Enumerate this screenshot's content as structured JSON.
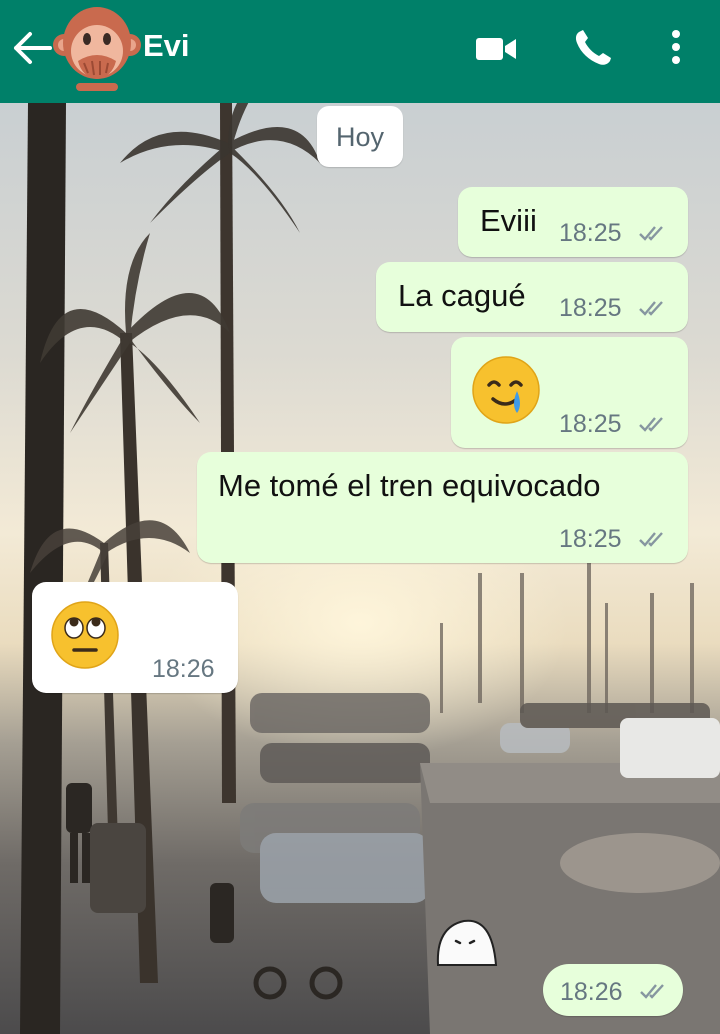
{
  "header": {
    "contact_name": "Evi",
    "icons": [
      "back-arrow-icon",
      "monkey-avatar",
      "video-call-icon",
      "phone-icon",
      "more-options-icon"
    ],
    "color": "#008069"
  },
  "date_divider": "Hoy",
  "messages": [
    {
      "direction": "outgoing",
      "text": "Eviii",
      "time": "18:25",
      "status": "read-double-check"
    },
    {
      "direction": "outgoing",
      "text": "La cagué",
      "time": "18:25",
      "status": "read-double-check"
    },
    {
      "direction": "outgoing",
      "emoji": "crying-face-emoji",
      "time": "18:25",
      "status": "read-double-check"
    },
    {
      "direction": "outgoing",
      "text": "Me tomé el tren equivocado",
      "time": "18:25",
      "status": "read-double-check"
    },
    {
      "direction": "incoming",
      "emoji": "rolling-eyes-emoji",
      "time": "18:26"
    },
    {
      "direction": "outgoing",
      "sticker": "white-blob-sticker",
      "time": "18:26",
      "status": "read-double-check"
    }
  ],
  "colors": {
    "outgoing_bubble": "#e7ffdb",
    "incoming_bubble": "#ffffff",
    "tick": "#8696a0"
  }
}
